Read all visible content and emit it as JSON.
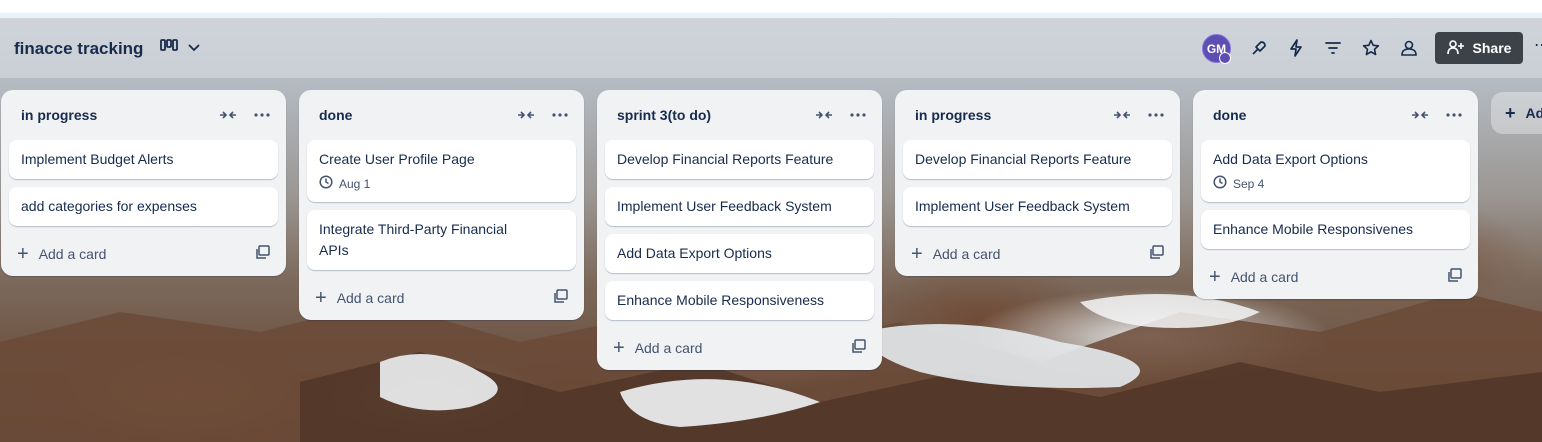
{
  "board": {
    "title": "finacce tracking",
    "view_icon": "board-view-icon"
  },
  "header": {
    "avatar_initials": "GM",
    "share_label": "Share",
    "icons": [
      "power-ups-icon",
      "automation-icon",
      "filter-icon",
      "star-icon",
      "members-icon",
      "add-person-icon",
      "more-icon"
    ]
  },
  "lists": [
    {
      "title": "in progress",
      "cards": [
        {
          "title": "Implement Budget Alerts"
        },
        {
          "title": "add categories for expenses"
        }
      ],
      "add_label": "Add a card"
    },
    {
      "title": "done",
      "cards": [
        {
          "title": "Create User Profile Page",
          "date": "Aug 1"
        },
        {
          "title": "Integrate Third-Party Financial APIs"
        }
      ],
      "add_label": "Add a card"
    },
    {
      "title": "sprint 3(to do)",
      "cards": [
        {
          "title": "Develop Financial Reports Feature"
        },
        {
          "title": "Implement User Feedback System"
        },
        {
          "title": "Add Data Export Options"
        },
        {
          "title": "Enhance Mobile Responsiveness"
        }
      ],
      "add_label": "Add a card"
    },
    {
      "title": "in progress",
      "cards": [
        {
          "title": "Develop Financial Reports Feature"
        },
        {
          "title": "Implement User Feedback System"
        }
      ],
      "add_label": "Add a card"
    },
    {
      "title": "done",
      "cards": [
        {
          "title": "Add Data Export Options",
          "date": "Sep 4"
        },
        {
          "title": "Enhance Mobile Responsivenes"
        }
      ],
      "add_label": "Add a card"
    }
  ],
  "add_list_label": "Ad"
}
